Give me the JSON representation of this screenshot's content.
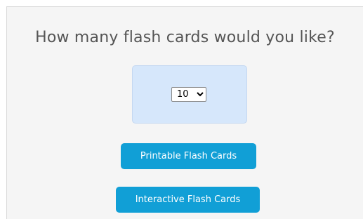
{
  "prompt": {
    "title": "How many flash cards would you like?"
  },
  "count_select": {
    "selected": "10",
    "options": [
      "10"
    ]
  },
  "buttons": {
    "printable_label": "Printable Flash Cards",
    "interactive_label": "Interactive Flash Cards"
  },
  "colors": {
    "button_bg": "#119fd6",
    "select_panel_bg": "#d6e7fb",
    "page_bg": "#f5f5f5",
    "title_text": "#555555"
  }
}
